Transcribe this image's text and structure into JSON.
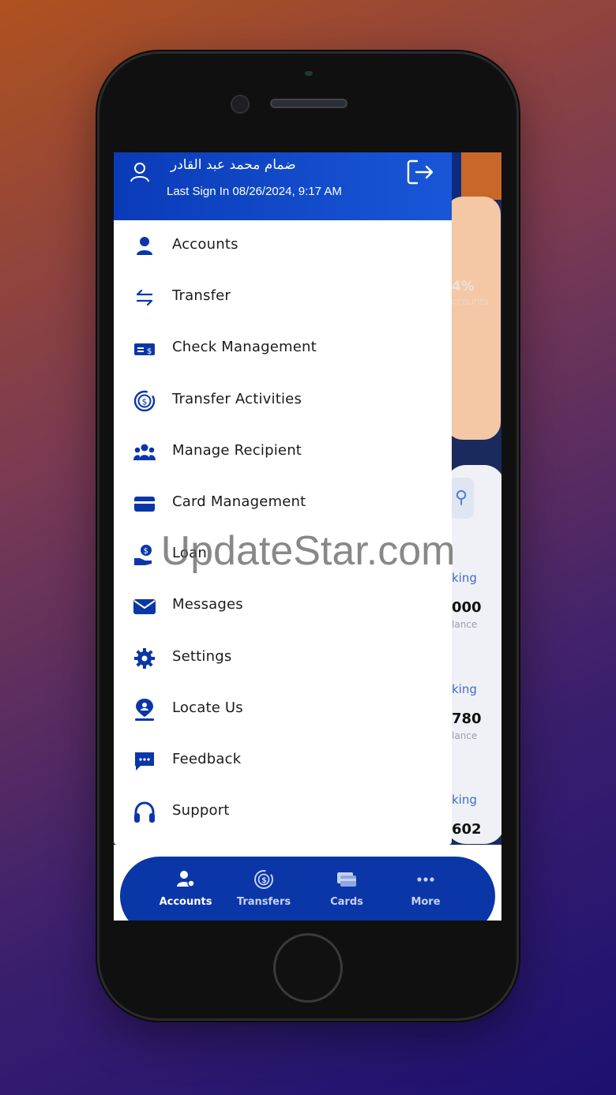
{
  "drawer": {
    "user_name": "ضمام محمد عبد القادر",
    "last_sign_in": "Last Sign In 08/26/2024, 9:17 AM",
    "items": [
      {
        "label": "Accounts",
        "icon": "user-icon"
      },
      {
        "label": "Transfer",
        "icon": "transfer-arrows-icon"
      },
      {
        "label": "Check Management",
        "icon": "check-dollar-icon"
      },
      {
        "label": "Transfer Activities",
        "icon": "dollar-cycle-icon"
      },
      {
        "label": "Manage Recipient",
        "icon": "group-icon"
      },
      {
        "label": "Card Management",
        "icon": "card-icon"
      },
      {
        "label": "Loan",
        "icon": "loan-hand-icon"
      },
      {
        "label": "Messages",
        "icon": "envelope-icon"
      },
      {
        "label": "Settings",
        "icon": "gear-icon"
      },
      {
        "label": "Locate Us",
        "icon": "location-user-icon"
      },
      {
        "label": "Feedback",
        "icon": "chat-bubble-icon"
      },
      {
        "label": "Support",
        "icon": "headset-icon"
      }
    ]
  },
  "background": {
    "percent": "4%",
    "accounts": "ccounts",
    "rows": [
      {
        "type": "king",
        "value": "000",
        "label": "lance"
      },
      {
        "type": "king",
        "value": "780",
        "label": "lance"
      },
      {
        "type": "king",
        "value": "602",
        "label": ""
      }
    ]
  },
  "bottom_nav": [
    {
      "label": "Accounts",
      "icon": "accounts-icon",
      "active": true
    },
    {
      "label": "Transfers",
      "icon": "transfers-icon",
      "active": false
    },
    {
      "label": "Cards",
      "icon": "cards-icon",
      "active": false
    },
    {
      "label": "More",
      "icon": "more-dots-icon",
      "active": false
    }
  ],
  "watermark": "UpdateStar.com",
  "colors": {
    "primary": "#0a36a8",
    "header": "#1857d8",
    "icon": "#0a36a8"
  }
}
